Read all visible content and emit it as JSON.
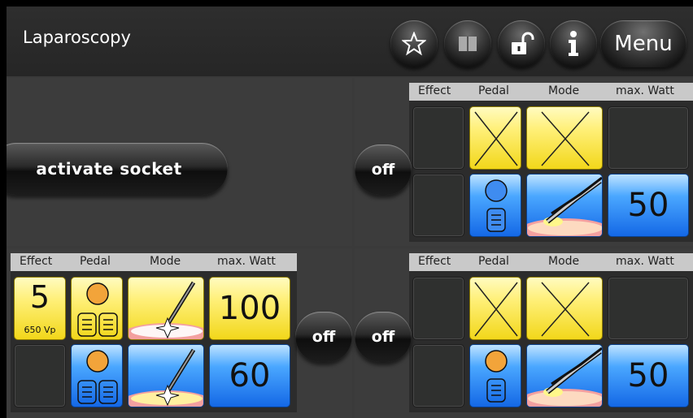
{
  "app": {
    "title": "Laparoscopy"
  },
  "header": {
    "buttons": [
      {
        "name": "favorites",
        "icon": "star-icon"
      },
      {
        "name": "manual",
        "icon": "book-icon"
      },
      {
        "name": "lock",
        "icon": "unlock-icon"
      },
      {
        "name": "info",
        "icon": "info-icon"
      }
    ],
    "menu_label": "Menu"
  },
  "columns": {
    "effect": "Effect",
    "pedal": "Pedal",
    "mode": "Mode",
    "max_watt": "max. Watt"
  },
  "sockets": {
    "top_left": {
      "action_label": "activate socket"
    },
    "top_right": {
      "state_label": "off",
      "row1": {
        "effect": "",
        "pedal_icon": "cross-icon",
        "mode_icon": "cross-icon",
        "max_watt": ""
      },
      "row2": {
        "effect": "",
        "pedal_icon": "single-pedal-icon",
        "mode_icon": "bipolar-forceps-icon",
        "max_watt": "50"
      }
    },
    "bottom_left": {
      "state_label": "off",
      "row1": {
        "effect": "5",
        "effect_sub": "650 Vp",
        "pedal_icon": "double-pedal-icon",
        "mode_icon": "monopolar-cut-icon",
        "max_watt": "100"
      },
      "row2": {
        "effect": "",
        "pedal_icon": "double-pedal-icon",
        "mode_icon": "monopolar-coag-icon",
        "max_watt": "60"
      }
    },
    "bottom_right": {
      "state_label": "off",
      "row1": {
        "effect": "",
        "pedal_icon": "cross-icon",
        "mode_icon": "cross-icon",
        "max_watt": ""
      },
      "row2": {
        "effect": "",
        "pedal_icon": "single-pedal-icon",
        "mode_icon": "bipolar-forceps-icon",
        "max_watt": "50"
      }
    }
  },
  "colors": {
    "active_yellow": "#f2d71a",
    "active_blue": "#1468e6",
    "background": "#3c3c3c"
  }
}
